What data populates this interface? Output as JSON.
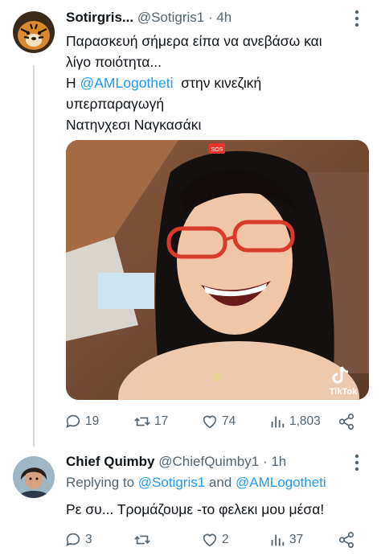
{
  "tweet1": {
    "display_name": "Sotirgris...",
    "handle": "@Sotigris1",
    "time": "4h",
    "lines": [
      "Παρασκευή σήμερα είπα να ανεβάσω και",
      "λίγο ποιότητα...",
      "Η ",
      "υπερπαραγωγή",
      "Νατηνχεσι Ναγκασάκι"
    ],
    "mention": "@AMLogotheti",
    "after_mention": "  στην κινεζική",
    "video_badge": "SOS",
    "tiktok_label": "TikTok",
    "stats": {
      "replies": "19",
      "retweets": "17",
      "likes": "74",
      "views": "1,803"
    }
  },
  "tweet2": {
    "display_name": "Chief Quimby",
    "handle": "@ChiefQuimby1",
    "time": "1h",
    "replying_prefix": "Replying to ",
    "replying_user1": "@Sotigris1",
    "replying_and": " and ",
    "replying_user2": "@AMLogotheti",
    "text": "Ρε συ... Τρομάζουμε -το φελεκι μου μέσα!",
    "stats": {
      "replies": "3",
      "retweets": "",
      "likes": "2",
      "views": "37"
    }
  },
  "separator": " · ",
  "colors": {
    "accent": "#1d9bf0",
    "muted": "#536471",
    "text": "#0f1419"
  }
}
